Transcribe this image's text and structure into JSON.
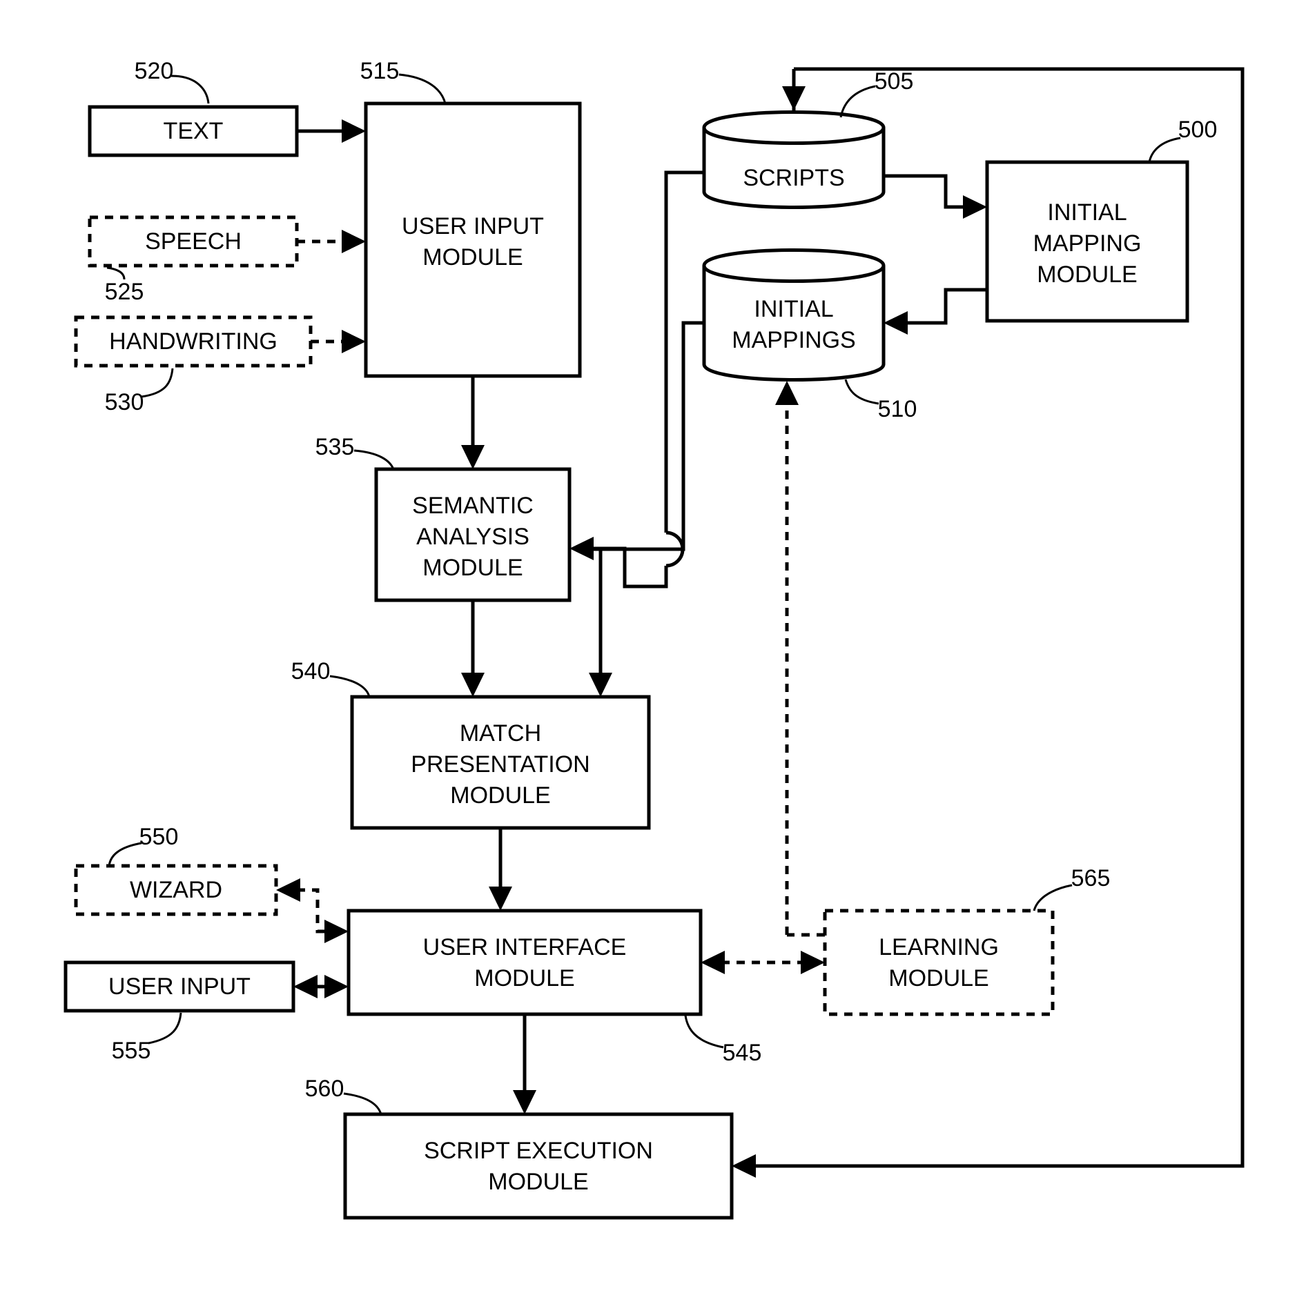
{
  "boxes": {
    "text": {
      "label1": "TEXT",
      "ref": "520"
    },
    "speech": {
      "label1": "SPEECH",
      "ref": "525"
    },
    "handwriting": {
      "label1": "HANDWRITING",
      "ref": "530"
    },
    "user_input_module": {
      "label1": "USER INPUT",
      "label2": "MODULE",
      "ref": "515"
    },
    "scripts": {
      "label1": "SCRIPTS",
      "ref": "505"
    },
    "initial_mappings": {
      "label1": "INITIAL",
      "label2": "MAPPINGS",
      "ref": "510"
    },
    "initial_mapping_module": {
      "label1": "INITIAL",
      "label2": "MAPPING",
      "label3": "MODULE",
      "ref": "500"
    },
    "semantic": {
      "label1": "SEMANTIC",
      "label2": "ANALYSIS",
      "label3": "MODULE",
      "ref": "535"
    },
    "match": {
      "label1": "MATCH",
      "label2": "PRESENTATION",
      "label3": "MODULE",
      "ref": "540"
    },
    "wizard": {
      "label1": "WIZARD",
      "ref": "550"
    },
    "user_input": {
      "label1": "USER INPUT",
      "ref": "555"
    },
    "ui_module": {
      "label1": "USER INTERFACE",
      "label2": "MODULE",
      "ref": "545"
    },
    "learning": {
      "label1": "LEARNING",
      "label2": "MODULE",
      "ref": "565"
    },
    "script_exec": {
      "label1": "SCRIPT EXECUTION",
      "label2": "MODULE",
      "ref": "560"
    }
  }
}
